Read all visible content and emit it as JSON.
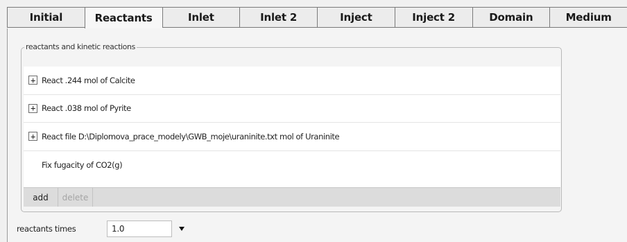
{
  "tabs": [
    {
      "label": "Initial",
      "active": false
    },
    {
      "label": "Reactants",
      "active": true
    },
    {
      "label": "Inlet",
      "active": false
    },
    {
      "label": "Inlet 2",
      "active": false
    },
    {
      "label": "Inject",
      "active": false
    },
    {
      "label": "Inject 2",
      "active": false
    },
    {
      "label": "Domain",
      "active": false
    },
    {
      "label": "Medium",
      "active": false
    }
  ],
  "reactants_group": {
    "legend": "reactants and kinetic reactions",
    "items": [
      {
        "label": "React .244 mol of Calcite",
        "expander": "+"
      },
      {
        "label": "React .038 mol of Pyrite",
        "expander": "+"
      },
      {
        "label": "React file D:\\Diplomova_prace_modely\\GWB_moje\\uraninite.txt mol of Uraninite",
        "expander": "+"
      },
      {
        "label": "Fix fugacity of CO2(g)",
        "expander": ""
      }
    ],
    "add_label": "add",
    "delete_label": "delete"
  },
  "reactants_times": {
    "label": "reactants times",
    "value": "1.0"
  },
  "colors": {
    "tab_border": "#7a7a7a",
    "list_background": "#ffffff",
    "button_bar": "#dcdcdc",
    "disabled_text": "#a5a5a5"
  }
}
